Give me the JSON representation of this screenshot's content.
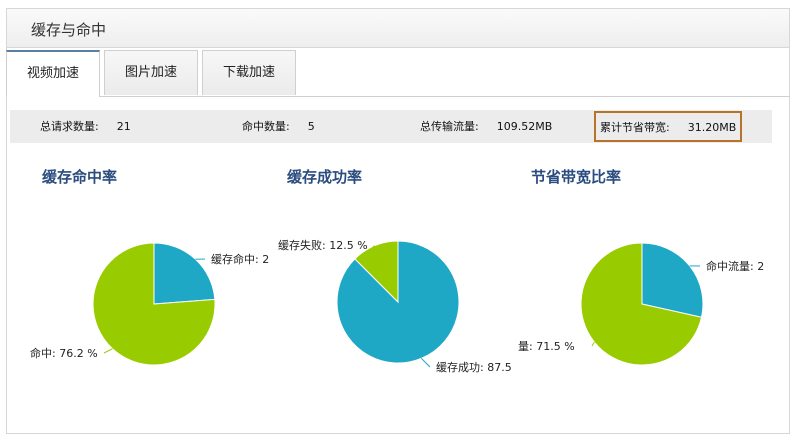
{
  "panel": {
    "title": "缓存与命中"
  },
  "tabs": [
    {
      "label": "视频加速",
      "active": true
    },
    {
      "label": "图片加速",
      "active": false
    },
    {
      "label": "下载加速",
      "active": false
    }
  ],
  "stats": [
    {
      "label": "总请求数量:",
      "value": "21"
    },
    {
      "label": "命中数量:",
      "value": "5"
    },
    {
      "label": "总传输流量:",
      "value": "109.52MB"
    },
    {
      "label": "累计节省带宽:",
      "value": "31.20MB",
      "highlighted": true
    }
  ],
  "colors": {
    "green": "#99cc00",
    "blue": "#1fa7c6",
    "title": "#2b4c7e",
    "highlight": "#b8732a"
  },
  "chart_data": [
    {
      "type": "pie",
      "title": "缓存命中率",
      "slices": [
        {
          "name": "缓存命中",
          "value": 23.8,
          "color": "#1fa7c6",
          "label_text": "缓存命中: 2"
        },
        {
          "name": "未命中",
          "value": 76.2,
          "color": "#99cc00",
          "label_text": "命中: 76.2 %"
        }
      ]
    },
    {
      "type": "pie",
      "title": "缓存成功率",
      "slices": [
        {
          "name": "缓存成功",
          "value": 87.5,
          "color": "#1fa7c6",
          "label_text": "缓存成功: 87.5"
        },
        {
          "name": "缓存失败",
          "value": 12.5,
          "color": "#99cc00",
          "label_text": "缓存失败: 12.5 %"
        }
      ]
    },
    {
      "type": "pie",
      "title": "节省带宽比率",
      "slices": [
        {
          "name": "命中流量",
          "value": 28.5,
          "color": "#1fa7c6",
          "label_text": "命中流量: 2"
        },
        {
          "name": "未命中流量",
          "value": 71.5,
          "color": "#99cc00",
          "label_text": "量: 71.5 %"
        }
      ]
    }
  ]
}
